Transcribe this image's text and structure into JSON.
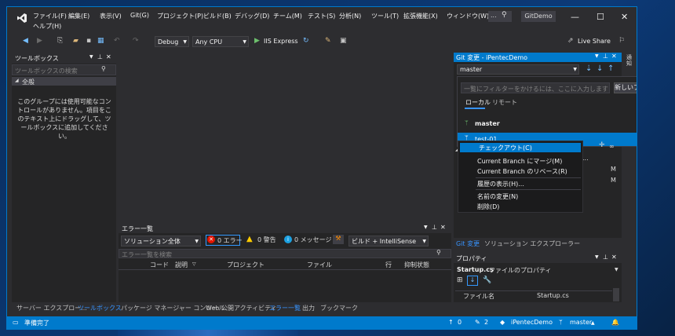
{
  "window": {
    "solution_name": "GitDemo",
    "menu": [
      "ファイル(F)",
      "編集(E)",
      "表示(V)",
      "Git(G)",
      "プロジェクト(P)",
      "ビルド(B)",
      "デバッグ(D)",
      "チーム(M)",
      "テスト(S)",
      "分析(N)",
      "ツール(T)",
      "拡張機能(X)",
      "ウィンドウ(W)",
      "ヘルプ(H)"
    ],
    "more": "..."
  },
  "toolbar": {
    "config": "Debug",
    "platform": "Any CPU",
    "run_label": "IIS Express",
    "live_share": "Live Share"
  },
  "toolbox": {
    "title": "ツールボックス",
    "search_placeholder": "ツールボックスの検索",
    "group": "全般",
    "empty_message": "このグループには使用可能なコントロールがありません。項目をこのテキスト上にドラッグして、ツールボックスに追加してください。",
    "bottom_tabs": [
      "サーバー エクスプロー...",
      "ツールボックス"
    ]
  },
  "errors": {
    "title": "エラー一覧",
    "scope": "ソリューション全体",
    "errors_label": "0 エラー",
    "warnings_label": "0 警告",
    "messages_label": "0 メッセージ",
    "build_filter": "ビルド + IntelliSense",
    "search_placeholder": "エラー一覧を検索",
    "columns": [
      "コード",
      "説明",
      "プロジェクト",
      "ファイル",
      "行",
      "抑制状態"
    ]
  },
  "bottom_tabs": [
    "パッケージ マネージャー コンソール",
    "Web 公開アクティビティ",
    "エラー一覧",
    "出力",
    "ブックマーク"
  ],
  "git": {
    "title": "Git 変更 - iPentecDemo",
    "branch": "master",
    "filter_placeholder": "一覧にフィルターをかけるには、ここに入力します",
    "new_branch": "新しいブランチ(N)",
    "tabs": [
      "ローカル",
      "リモート"
    ],
    "branches": [
      "master",
      "test-01"
    ],
    "context_menu": [
      "チェックアウト(C)",
      "Current Branch にマージ(M)",
      "Current Branch のリベース(R)",
      "履歴の表示(H)...",
      "名前の変更(N)",
      "削除(D)"
    ],
    "partial_text": "...",
    "status_marks": [
      "M",
      "M"
    ],
    "bottom_tabs": [
      "Git 変更",
      "ソリューション エクスプローラー"
    ],
    "side_tab": "通知"
  },
  "properties": {
    "title": "プロパティ",
    "object": "Startup.cs",
    "object_kind": "ファイルのプロパティ",
    "prop_name": "ファイル名",
    "prop_value": "Startup.cs"
  },
  "status": {
    "ready": "準備完了",
    "up": "0",
    "pencil": "2",
    "repo": "iPentecDemo",
    "branch": "master"
  }
}
